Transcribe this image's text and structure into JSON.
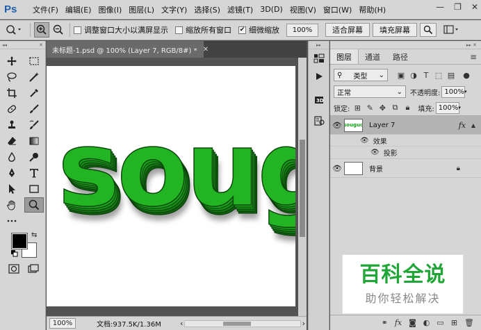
{
  "app": {
    "logo": "Ps"
  },
  "menu": [
    "文件(F)",
    "编辑(E)",
    "图像(I)",
    "图层(L)",
    "文字(Y)",
    "选择(S)",
    "滤镜(T)",
    "3D(D)",
    "视图(V)",
    "窗口(W)",
    "帮助(H)"
  ],
  "window_controls": {
    "minimize": "—",
    "restore": "❐",
    "close": "✕"
  },
  "options": {
    "resize_windows": {
      "label": "调整窗口大小以满屏显示",
      "checked": false
    },
    "zoom_all": {
      "label": "缩放所有窗口",
      "checked": false
    },
    "scrubby_zoom": {
      "label": "细微缩放",
      "checked": true
    },
    "zoom_value": "100%",
    "fit_screen": "适合屏幕",
    "fill_screen": "填充屏幕"
  },
  "document": {
    "tab_title": "未标题-1.psd @ 100% (Layer 7, RGB/8#) *",
    "close": "✕",
    "canvas_text": "soug"
  },
  "statusbar": {
    "zoom": "100%",
    "doc_info": "文档:937.5K/1.36M",
    "left_arrow": "‹",
    "right_arrow": "›"
  },
  "layers_panel": {
    "tabs": [
      "图层",
      "通道",
      "路径"
    ],
    "active_tab": 0,
    "filter_kind": "类型",
    "blend_mode": "正常",
    "opacity_label": "不透明度:",
    "opacity": "100%",
    "lock_label": "锁定:",
    "fill_label": "填充:",
    "fill": "100%",
    "layers": [
      {
        "name": "Layer 7",
        "thumb_text": "souguo",
        "fx": "fx",
        "selected": true
      },
      {
        "name": "背景",
        "locked": true,
        "selected": false
      }
    ],
    "effects_label": "效果",
    "effect_name": "投影"
  },
  "watermark": {
    "title": "百科全说",
    "subtitle": "助你轻松解决"
  },
  "colors": {
    "text_green": "#22b422",
    "shadow": "#555555",
    "watermark_green": "#1fa636"
  }
}
